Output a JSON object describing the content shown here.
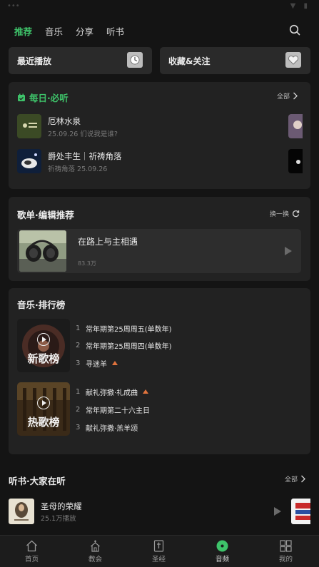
{
  "top_tabs": [
    "推荐",
    "音乐",
    "分享",
    "听书"
  ],
  "quick": {
    "recent": "最近播放",
    "favorites": "收藏&关注"
  },
  "daily": {
    "title": "每日·必听",
    "more": "全部",
    "items": [
      {
        "title": "厄林水泉",
        "sub": "25.09.26 们说我是谁?"
      },
      {
        "title": "爵处丰生｜祈祷角落",
        "sub": "祈祷角落 25.09.26"
      }
    ]
  },
  "playlist": {
    "title": "歌单·编辑推荐",
    "refresh": "换一换",
    "card": {
      "title": "在路上与主相遇",
      "count": "83.3万"
    }
  },
  "charts": {
    "title": "音乐·排行榜",
    "boards": [
      {
        "cover": "新歌榜",
        "items": [
          {
            "num": "1",
            "title": "常年期第25周周五(单数年)",
            "up": false
          },
          {
            "num": "2",
            "title": "常年期第25周周四(单数年)",
            "up": false
          },
          {
            "num": "3",
            "title": "寻迷羊",
            "up": true
          }
        ]
      },
      {
        "cover": "热歌榜",
        "items": [
          {
            "num": "1",
            "title": "献礼弥撒·礼成曲",
            "up": true
          },
          {
            "num": "2",
            "title": "常年期第二十六主日",
            "up": false
          },
          {
            "num": "3",
            "title": "献礼弥撒·羔羊颂",
            "up": false
          }
        ]
      }
    ]
  },
  "books": {
    "title": "听书·大家在听",
    "more": "全部",
    "item": {
      "title": "圣母的荣耀",
      "sub": "25.1万播放"
    }
  },
  "nav": [
    "首页",
    "教会",
    "圣经",
    "音频",
    "我的"
  ],
  "colors": {
    "accent": "#3ec36a",
    "bg": "#141414",
    "panel": "#222222",
    "hot": "#e0733d"
  }
}
